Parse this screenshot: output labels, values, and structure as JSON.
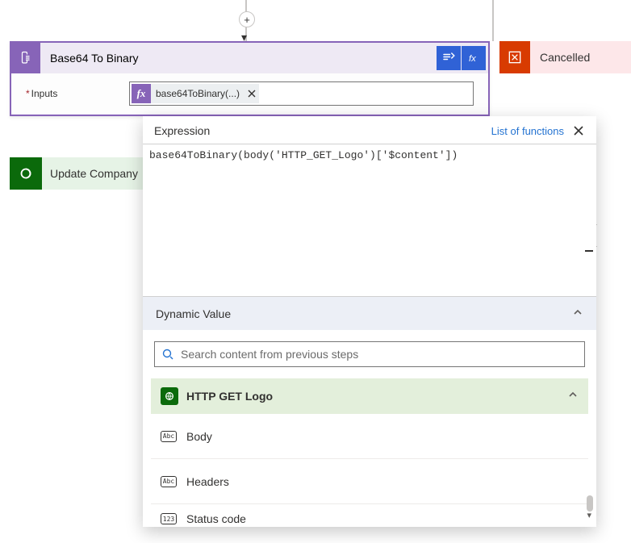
{
  "connector": {
    "insert_tooltip": "+"
  },
  "base64_card": {
    "title": "Base64 To Binary",
    "input_label": "Inputs",
    "chip_label": "base64ToBinary(...)"
  },
  "cancelled_card": {
    "title": "Cancelled"
  },
  "update_card": {
    "title": "Update Company"
  },
  "popover": {
    "title": "Expression",
    "link": "List of functions",
    "expression": "base64ToBinary(body('HTTP_GET_Logo')['$content'])",
    "section": "Dynamic Value",
    "search_placeholder": "Search content from previous steps",
    "source": "HTTP GET Logo",
    "items": [
      {
        "icon": "Abc",
        "name": "Body"
      },
      {
        "icon": "Abc",
        "name": "Headers"
      },
      {
        "icon": "123",
        "name": "Status code"
      }
    ]
  }
}
